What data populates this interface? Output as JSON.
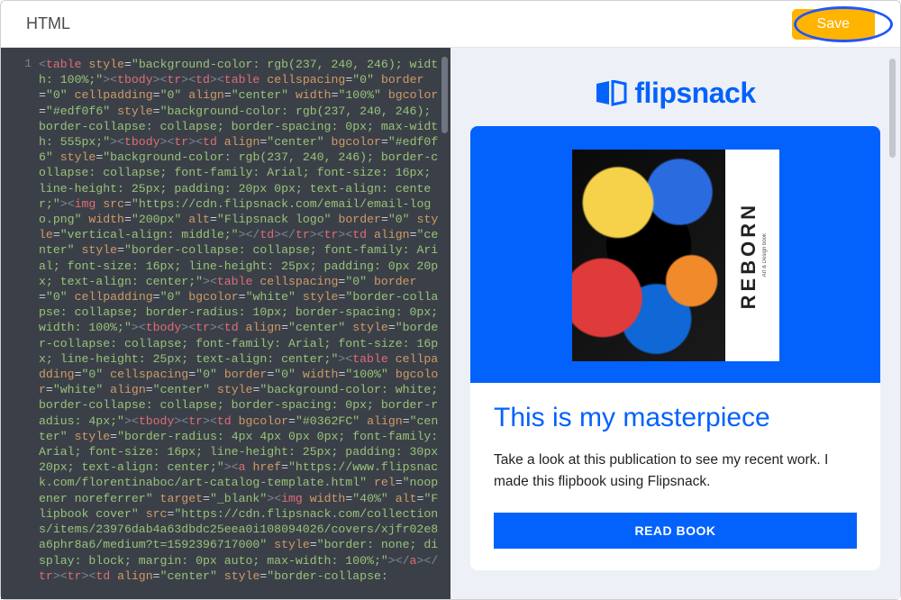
{
  "topbar": {
    "title": "HTML",
    "save_label": "Save"
  },
  "editor": {
    "line_number": "1",
    "tokens": [
      {
        "c": "t-punc",
        "t": "<"
      },
      {
        "c": "t-tag",
        "t": "table"
      },
      {
        "c": "",
        "t": " "
      },
      {
        "c": "t-attr",
        "t": "style"
      },
      {
        "c": "t-eq",
        "t": "="
      },
      {
        "c": "t-str",
        "t": "\"background-color: rgb(237, 240, 246); width: 100%;\""
      },
      {
        "c": "t-punc",
        "t": "><"
      },
      {
        "c": "t-tag",
        "t": "tbody"
      },
      {
        "c": "t-punc",
        "t": "><"
      },
      {
        "c": "t-tag",
        "t": "tr"
      },
      {
        "c": "t-punc",
        "t": "><"
      },
      {
        "c": "t-tag",
        "t": "td"
      },
      {
        "c": "t-punc",
        "t": "><"
      },
      {
        "c": "t-tag",
        "t": "table"
      },
      {
        "c": "",
        "t": " "
      },
      {
        "c": "t-attr",
        "t": "cellspacing"
      },
      {
        "c": "t-eq",
        "t": "="
      },
      {
        "c": "t-str",
        "t": "\"0\""
      },
      {
        "c": "",
        "t": " "
      },
      {
        "c": "t-attr",
        "t": "border"
      },
      {
        "c": "t-eq",
        "t": "="
      },
      {
        "c": "t-str",
        "t": "\"0\""
      },
      {
        "c": "",
        "t": " "
      },
      {
        "c": "t-attr",
        "t": "cellpadding"
      },
      {
        "c": "t-eq",
        "t": "="
      },
      {
        "c": "t-str",
        "t": "\"0\""
      },
      {
        "c": "",
        "t": " "
      },
      {
        "c": "t-attr",
        "t": "align"
      },
      {
        "c": "t-eq",
        "t": "="
      },
      {
        "c": "t-str",
        "t": "\"center\""
      },
      {
        "c": "",
        "t": " "
      },
      {
        "c": "t-attr",
        "t": "width"
      },
      {
        "c": "t-eq",
        "t": "="
      },
      {
        "c": "t-str",
        "t": "\"100%\""
      },
      {
        "c": "",
        "t": " "
      },
      {
        "c": "t-attr",
        "t": "bgcolor"
      },
      {
        "c": "t-eq",
        "t": "="
      },
      {
        "c": "t-str",
        "t": "\"#edf0f6\""
      },
      {
        "c": "",
        "t": " "
      },
      {
        "c": "t-attr",
        "t": "style"
      },
      {
        "c": "t-eq",
        "t": "="
      },
      {
        "c": "t-str",
        "t": "\"background-color: rgb(237, 240, 246); border-collapse: collapse; border-spacing: 0px; max-width: 555px;\""
      },
      {
        "c": "t-punc",
        "t": "><"
      },
      {
        "c": "t-tag",
        "t": "tbody"
      },
      {
        "c": "t-punc",
        "t": "><"
      },
      {
        "c": "t-tag",
        "t": "tr"
      },
      {
        "c": "t-punc",
        "t": ">"
      },
      {
        "c": "t-punc",
        "t": "<"
      },
      {
        "c": "t-tag",
        "t": "td"
      },
      {
        "c": "",
        "t": " "
      },
      {
        "c": "t-attr",
        "t": "align"
      },
      {
        "c": "t-eq",
        "t": "="
      },
      {
        "c": "t-str",
        "t": "\"center\""
      },
      {
        "c": "",
        "t": " "
      },
      {
        "c": "t-attr",
        "t": "bgcolor"
      },
      {
        "c": "t-eq",
        "t": "="
      },
      {
        "c": "t-str",
        "t": "\"#edf0f6\""
      },
      {
        "c": "",
        "t": " "
      },
      {
        "c": "t-attr",
        "t": "style"
      },
      {
        "c": "t-eq",
        "t": "="
      },
      {
        "c": "t-str",
        "t": "\"background-color: rgb(237, 240, 246); border-collapse: collapse; font-family: Arial; font-size: 16px; line-height: 25px; padding: 20px 0px; text-align: center;\""
      },
      {
        "c": "t-punc",
        "t": "><"
      },
      {
        "c": "t-tag",
        "t": "img"
      },
      {
        "c": "",
        "t": " "
      },
      {
        "c": "t-attr",
        "t": "src"
      },
      {
        "c": "t-eq",
        "t": "="
      },
      {
        "c": "t-str",
        "t": "\"https://cdn.flipsnack.com/email/email-logo.png\""
      },
      {
        "c": "",
        "t": " "
      },
      {
        "c": "t-attr",
        "t": "width"
      },
      {
        "c": "t-eq",
        "t": "="
      },
      {
        "c": "t-str",
        "t": "\"200px\""
      },
      {
        "c": "",
        "t": " "
      },
      {
        "c": "t-attr",
        "t": "alt"
      },
      {
        "c": "t-eq",
        "t": "="
      },
      {
        "c": "t-str",
        "t": "\"Flipsnack logo\""
      },
      {
        "c": "",
        "t": " "
      },
      {
        "c": "t-attr",
        "t": "border"
      },
      {
        "c": "t-eq",
        "t": "="
      },
      {
        "c": "t-str",
        "t": "\"0\""
      },
      {
        "c": "",
        "t": " "
      },
      {
        "c": "t-attr",
        "t": "style"
      },
      {
        "c": "t-eq",
        "t": "="
      },
      {
        "c": "t-str",
        "t": "\"vertical-align: middle;\""
      },
      {
        "c": "t-punc",
        "t": "></"
      },
      {
        "c": "t-tag",
        "t": "td"
      },
      {
        "c": "t-punc",
        "t": "></"
      },
      {
        "c": "t-tag",
        "t": "tr"
      },
      {
        "c": "t-punc",
        "t": "><"
      },
      {
        "c": "t-tag",
        "t": "tr"
      },
      {
        "c": "t-punc",
        "t": "><"
      },
      {
        "c": "t-tag",
        "t": "td"
      },
      {
        "c": "",
        "t": " "
      },
      {
        "c": "t-attr",
        "t": "align"
      },
      {
        "c": "t-eq",
        "t": "="
      },
      {
        "c": "t-str",
        "t": "\"center\""
      },
      {
        "c": "",
        "t": " "
      },
      {
        "c": "t-attr",
        "t": "style"
      },
      {
        "c": "t-eq",
        "t": "="
      },
      {
        "c": "t-str",
        "t": "\"border-collapse: collapse; font-family: Arial; font-size: 16px; line-height: 25px; padding: 0px 20px; text-align: center;\""
      },
      {
        "c": "t-punc",
        "t": "><"
      },
      {
        "c": "t-tag",
        "t": "table"
      },
      {
        "c": "",
        "t": " "
      },
      {
        "c": "t-attr",
        "t": "cellspacing"
      },
      {
        "c": "t-eq",
        "t": "="
      },
      {
        "c": "t-str",
        "t": "\"0\""
      },
      {
        "c": "",
        "t": " "
      },
      {
        "c": "t-attr",
        "t": "border"
      },
      {
        "c": "t-eq",
        "t": "="
      },
      {
        "c": "t-str",
        "t": "\"0\""
      },
      {
        "c": "",
        "t": " "
      },
      {
        "c": "t-attr",
        "t": "cellpadding"
      },
      {
        "c": "t-eq",
        "t": "="
      },
      {
        "c": "t-str",
        "t": "\"0\""
      },
      {
        "c": "",
        "t": " "
      },
      {
        "c": "t-attr",
        "t": "bgcolor"
      },
      {
        "c": "t-eq",
        "t": "="
      },
      {
        "c": "t-str",
        "t": "\"white\""
      },
      {
        "c": "",
        "t": " "
      },
      {
        "c": "t-attr",
        "t": "style"
      },
      {
        "c": "t-eq",
        "t": "="
      },
      {
        "c": "t-str",
        "t": "\"border-collapse: collapse; border-radius: 10px; border-spacing: 0px; width: 100%;\""
      },
      {
        "c": "t-punc",
        "t": "><"
      },
      {
        "c": "t-tag",
        "t": "tbody"
      },
      {
        "c": "t-punc",
        "t": "><"
      },
      {
        "c": "t-tag",
        "t": "tr"
      },
      {
        "c": "t-punc",
        "t": "><"
      },
      {
        "c": "t-tag",
        "t": "td"
      },
      {
        "c": "",
        "t": " "
      },
      {
        "c": "t-attr",
        "t": "align"
      },
      {
        "c": "t-eq",
        "t": "="
      },
      {
        "c": "t-str",
        "t": "\"center\""
      },
      {
        "c": "",
        "t": " "
      },
      {
        "c": "t-attr",
        "t": "style"
      },
      {
        "c": "t-eq",
        "t": "="
      },
      {
        "c": "t-str",
        "t": "\"border-collapse: collapse; font-family: Arial; font-size: 16px; line-height: 25px; text-align: center;\""
      },
      {
        "c": "t-punc",
        "t": "><"
      },
      {
        "c": "t-tag",
        "t": "table"
      },
      {
        "c": "",
        "t": " "
      },
      {
        "c": "t-attr",
        "t": "cellpadding"
      },
      {
        "c": "t-eq",
        "t": "="
      },
      {
        "c": "t-str",
        "t": "\"0\""
      },
      {
        "c": "",
        "t": " "
      },
      {
        "c": "t-attr",
        "t": "cellspacing"
      },
      {
        "c": "t-eq",
        "t": "="
      },
      {
        "c": "t-str",
        "t": "\"0\""
      },
      {
        "c": "",
        "t": " "
      },
      {
        "c": "t-attr",
        "t": "border"
      },
      {
        "c": "t-eq",
        "t": "="
      },
      {
        "c": "t-str",
        "t": "\"0\""
      },
      {
        "c": "",
        "t": " "
      },
      {
        "c": "t-attr",
        "t": "width"
      },
      {
        "c": "t-eq",
        "t": "="
      },
      {
        "c": "t-str",
        "t": "\"100%\""
      },
      {
        "c": "",
        "t": " "
      },
      {
        "c": "t-attr",
        "t": "bgcolor"
      },
      {
        "c": "t-eq",
        "t": "="
      },
      {
        "c": "t-str",
        "t": "\"white\""
      },
      {
        "c": "",
        "t": " "
      },
      {
        "c": "t-attr",
        "t": "align"
      },
      {
        "c": "t-eq",
        "t": "="
      },
      {
        "c": "t-str",
        "t": "\"center\""
      },
      {
        "c": "",
        "t": " "
      },
      {
        "c": "t-attr",
        "t": "style"
      },
      {
        "c": "t-eq",
        "t": "="
      },
      {
        "c": "t-str",
        "t": "\"background-color: white; border-collapse: collapse; border-spacing: 0px; border-radius: 4px;\""
      },
      {
        "c": "t-punc",
        "t": ">"
      },
      {
        "c": "t-punc",
        "t": "<"
      },
      {
        "c": "t-tag",
        "t": "tbody"
      },
      {
        "c": "t-punc",
        "t": "><"
      },
      {
        "c": "t-tag",
        "t": "tr"
      },
      {
        "c": "t-punc",
        "t": "><"
      },
      {
        "c": "t-tag",
        "t": "td"
      },
      {
        "c": "",
        "t": " "
      },
      {
        "c": "t-attr",
        "t": "bgcolor"
      },
      {
        "c": "t-eq",
        "t": "="
      },
      {
        "c": "t-str",
        "t": "\"#0362FC\""
      },
      {
        "c": "",
        "t": " "
      },
      {
        "c": "t-attr",
        "t": "align"
      },
      {
        "c": "t-eq",
        "t": "="
      },
      {
        "c": "t-str",
        "t": "\"center\""
      },
      {
        "c": "",
        "t": " "
      },
      {
        "c": "t-attr",
        "t": "style"
      },
      {
        "c": "t-eq",
        "t": "="
      },
      {
        "c": "t-str",
        "t": "\"border-radius: 4px 4px 0px 0px; font-family: Arial; font-size: 16px; line-height: 25px; padding: 30px 20px; text-align: center;\""
      },
      {
        "c": "t-punc",
        "t": "><"
      },
      {
        "c": "t-tag",
        "t": "a"
      },
      {
        "c": "",
        "t": " "
      },
      {
        "c": "t-attr",
        "t": "href"
      },
      {
        "c": "t-eq",
        "t": "="
      },
      {
        "c": "t-str",
        "t": "\"https://www.flipsnack.com/florentinaboc/art-catalog-template.html\""
      },
      {
        "c": "",
        "t": " "
      },
      {
        "c": "t-attr",
        "t": "rel"
      },
      {
        "c": "t-eq",
        "t": "="
      },
      {
        "c": "t-str",
        "t": "\"noopener noreferrer\""
      },
      {
        "c": "",
        "t": " "
      },
      {
        "c": "t-attr",
        "t": "target"
      },
      {
        "c": "t-eq",
        "t": "="
      },
      {
        "c": "t-str",
        "t": "\"_blank\""
      },
      {
        "c": "t-punc",
        "t": "><"
      },
      {
        "c": "t-tag",
        "t": "img"
      },
      {
        "c": "",
        "t": " "
      },
      {
        "c": "t-attr",
        "t": "width"
      },
      {
        "c": "t-eq",
        "t": "="
      },
      {
        "c": "t-str",
        "t": "\"40%\""
      },
      {
        "c": "",
        "t": " "
      },
      {
        "c": "t-attr",
        "t": "alt"
      },
      {
        "c": "t-eq",
        "t": "="
      },
      {
        "c": "t-str",
        "t": "\"Flipbook cover\""
      },
      {
        "c": "",
        "t": " "
      },
      {
        "c": "t-attr",
        "t": "src"
      },
      {
        "c": "t-eq",
        "t": "="
      },
      {
        "c": "t-str",
        "t": "\"https://cdn.flipsnack.com/collections/items/23976dab4a63dbdc25eea0i108094026/covers/xjfr02e8a6phr8a6/medium?t=1592396717000\""
      },
      {
        "c": "",
        "t": " "
      },
      {
        "c": "t-attr",
        "t": "style"
      },
      {
        "c": "t-eq",
        "t": "="
      },
      {
        "c": "t-str",
        "t": "\"border: none; display: block; margin: 0px auto; max-width: 100%;\""
      },
      {
        "c": "t-punc",
        "t": "></"
      },
      {
        "c": "t-tag",
        "t": "a"
      },
      {
        "c": "t-punc",
        "t": ">"
      },
      {
        "c": "t-punc",
        "t": "</"
      },
      {
        "c": "t-tag",
        "t": "tr"
      },
      {
        "c": "t-punc",
        "t": "><"
      },
      {
        "c": "t-tag",
        "t": "tr"
      },
      {
        "c": "t-punc",
        "t": "><"
      },
      {
        "c": "t-tag",
        "t": "td"
      },
      {
        "c": "",
        "t": " "
      },
      {
        "c": "t-attr",
        "t": "align"
      },
      {
        "c": "t-eq",
        "t": "="
      },
      {
        "c": "t-str",
        "t": "\"center\""
      },
      {
        "c": "",
        "t": " "
      },
      {
        "c": "t-attr",
        "t": "style"
      },
      {
        "c": "t-eq",
        "t": "="
      },
      {
        "c": "t-str",
        "t": "\"border-collapse:"
      }
    ]
  },
  "preview": {
    "brand_name": "flipsnack",
    "cover_spine_title": "REBORN",
    "cover_spine_sub": "Art & Design book",
    "heading": "This is my masterpiece",
    "description": "Take a look at this publication to see my recent work. I made this flipbook using Flipsnack.",
    "cta_label": "READ BOOK"
  },
  "colors": {
    "accent": "#0362fc",
    "save": "#ffb400",
    "editor_bg": "#3b4048",
    "preview_bg": "#edf0f6"
  }
}
